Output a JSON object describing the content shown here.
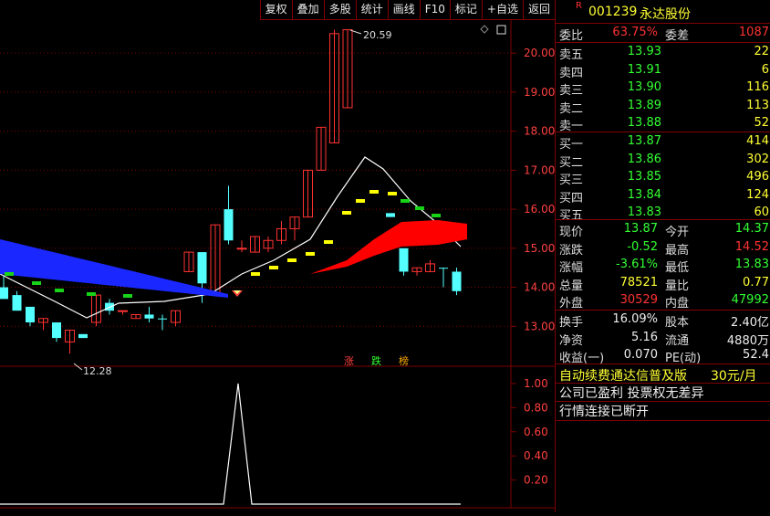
{
  "toolbar": [
    "复权",
    "叠加",
    "多股",
    "统计",
    "画线",
    "F10",
    "标记",
    "+自选",
    "返回"
  ],
  "price_axis": [
    "20.00",
    "19.00",
    "18.00",
    "17.00",
    "16.00",
    "15.00",
    "14.00",
    "13.00"
  ],
  "annotations": {
    "high": "20.59",
    "low": "12.28"
  },
  "tags": [
    "涨",
    "跌",
    "榜"
  ],
  "sub_axis": [
    "1.00",
    "0.80",
    "0.60",
    "0.40",
    "0.20"
  ],
  "header": {
    "badge": "R",
    "code": "001239",
    "name": "永达股份"
  },
  "weibi": {
    "label1": "委比",
    "v1": "63.75%",
    "label2": "委差",
    "v2": "1087"
  },
  "sell": [
    {
      "label": "卖五",
      "price": "13.93",
      "vol": "22"
    },
    {
      "label": "卖四",
      "price": "13.91",
      "vol": "6"
    },
    {
      "label": "卖三",
      "price": "13.90",
      "vol": "116"
    },
    {
      "label": "卖二",
      "price": "13.89",
      "vol": "113"
    },
    {
      "label": "卖一",
      "price": "13.88",
      "vol": "52"
    }
  ],
  "buy": [
    {
      "label": "买一",
      "price": "13.87",
      "vol": "414"
    },
    {
      "label": "买二",
      "price": "13.86",
      "vol": "302"
    },
    {
      "label": "买三",
      "price": "13.85",
      "vol": "496"
    },
    {
      "label": "买四",
      "price": "13.84",
      "vol": "124"
    },
    {
      "label": "买五",
      "price": "13.83",
      "vol": "60"
    }
  ],
  "stats": [
    {
      "l1": "现价",
      "v1": "13.87",
      "c1": "green",
      "l2": "今开",
      "v2": "14.37",
      "c2": "green"
    },
    {
      "l1": "涨跌",
      "v1": "-0.52",
      "c1": "green",
      "l2": "最高",
      "v2": "14.52",
      "c2": "red"
    },
    {
      "l1": "涨幅",
      "v1": "-3.61%",
      "c1": "green",
      "l2": "最低",
      "v2": "13.83",
      "c2": "green"
    },
    {
      "l1": "总量",
      "v1": "78521",
      "c1": "yellow",
      "l2": "量比",
      "v2": "0.77",
      "c2": "yellow"
    },
    {
      "l1": "外盘",
      "v1": "30529",
      "c1": "red",
      "l2": "内盘",
      "v2": "47992",
      "c2": "green"
    }
  ],
  "fundamentals": [
    {
      "l1": "换手",
      "v1": "16.09%",
      "l2": "股本",
      "v2": "2.40亿"
    },
    {
      "l1": "净资",
      "v1": "5.16",
      "l2": "流通",
      "v2": "4880万"
    },
    {
      "l1": "收益(一)",
      "v1": "0.070",
      "l2": "PE(动)",
      "v2": "52.4"
    }
  ],
  "notice": {
    "left": "自动续费通达信普及版",
    "right": "30元/月"
  },
  "lines": [
    "公司已盈利 投票权无差异",
    "行情连接已断开"
  ],
  "colors": {
    "up": "#ff3232",
    "down": "#54ffff",
    "border": "#800000",
    "ma": "#ffffff"
  },
  "chart_data": {
    "type": "candlestick",
    "ylim": [
      12.0,
      20.8
    ],
    "candles": [
      {
        "o": 14.0,
        "h": 14.3,
        "l": 13.8,
        "c": 13.7,
        "d": 1
      },
      {
        "o": 13.8,
        "h": 13.9,
        "l": 13.4,
        "c": 13.4,
        "d": 1
      },
      {
        "o": 13.5,
        "h": 13.5,
        "l": 13.0,
        "c": 13.1,
        "d": 1
      },
      {
        "o": 13.1,
        "h": 13.2,
        "l": 12.9,
        "c": 13.2,
        "d": 0
      },
      {
        "o": 13.1,
        "h": 13.1,
        "l": 12.6,
        "c": 12.7,
        "d": 1
      },
      {
        "o": 12.6,
        "h": 12.9,
        "l": 12.3,
        "c": 12.9,
        "d": 0
      },
      {
        "o": 12.8,
        "h": 12.8,
        "l": 12.7,
        "c": 12.7,
        "d": 1
      },
      {
        "o": 13.1,
        "h": 13.8,
        "l": 13.0,
        "c": 13.8,
        "d": 0
      },
      {
        "o": 13.6,
        "h": 13.7,
        "l": 13.3,
        "c": 13.4,
        "d": 1
      },
      {
        "o": 13.4,
        "h": 13.4,
        "l": 13.3,
        "c": 13.4,
        "d": 0
      },
      {
        "o": 13.2,
        "h": 13.3,
        "l": 13.2,
        "c": 13.3,
        "d": 0
      },
      {
        "o": 13.3,
        "h": 13.5,
        "l": 13.1,
        "c": 13.2,
        "d": 1
      },
      {
        "o": 13.2,
        "h": 13.3,
        "l": 12.9,
        "c": 13.2,
        "d": 1
      },
      {
        "o": 13.1,
        "h": 13.4,
        "l": 13.0,
        "c": 13.4,
        "d": 0
      },
      {
        "o": 14.4,
        "h": 14.9,
        "l": 14.4,
        "c": 14.9,
        "d": 0
      },
      {
        "o": 14.9,
        "h": 14.9,
        "l": 13.6,
        "c": 14.1,
        "d": 1
      },
      {
        "o": 13.8,
        "h": 15.6,
        "l": 13.8,
        "c": 15.6,
        "d": 0
      },
      {
        "o": 16.0,
        "h": 16.6,
        "l": 15.1,
        "c": 15.2,
        "d": 1
      },
      {
        "o": 15.0,
        "h": 15.2,
        "l": 14.9,
        "c": 15.0,
        "d": 0
      },
      {
        "o": 14.9,
        "h": 15.3,
        "l": 14.9,
        "c": 15.3,
        "d": 0
      },
      {
        "o": 15.0,
        "h": 15.3,
        "l": 14.9,
        "c": 15.2,
        "d": 0
      },
      {
        "o": 15.2,
        "h": 15.7,
        "l": 15.1,
        "c": 15.5,
        "d": 0
      },
      {
        "o": 15.5,
        "h": 15.8,
        "l": 15.2,
        "c": 15.8,
        "d": 0
      },
      {
        "o": 15.8,
        "h": 17.0,
        "l": 15.8,
        "c": 17.0,
        "d": 0
      },
      {
        "o": 17.0,
        "h": 18.1,
        "l": 17.0,
        "c": 18.1,
        "d": 0
      },
      {
        "o": 17.7,
        "h": 20.6,
        "l": 17.7,
        "c": 20.5,
        "d": 0
      },
      {
        "o": 20.6,
        "h": 20.6,
        "l": 18.6,
        "c": 18.6,
        "d": 0
      }
    ],
    "candles2": [
      {
        "o": 15.9,
        "h": 15.9,
        "l": 15.8,
        "c": 15.8,
        "d": 1
      },
      {
        "o": 15.0,
        "h": 15.0,
        "l": 14.3,
        "c": 14.4,
        "d": 1
      },
      {
        "o": 14.4,
        "h": 14.5,
        "l": 14.3,
        "c": 14.5,
        "d": 0
      },
      {
        "o": 14.4,
        "h": 14.7,
        "l": 14.4,
        "c": 14.6,
        "d": 0
      },
      {
        "o": 14.5,
        "h": 14.5,
        "l": 14.0,
        "c": 14.5,
        "d": 1
      },
      {
        "o": 14.4,
        "h": 14.5,
        "l": 13.8,
        "c": 13.9,
        "d": 1
      }
    ],
    "sub_values": [
      0,
      0,
      0,
      0,
      0,
      0,
      0,
      0,
      0,
      0,
      0,
      0,
      0,
      0,
      0,
      0,
      1,
      0,
      0,
      0,
      0,
      0,
      0,
      0,
      0,
      0,
      0,
      0,
      0,
      0,
      0,
      0
    ]
  }
}
